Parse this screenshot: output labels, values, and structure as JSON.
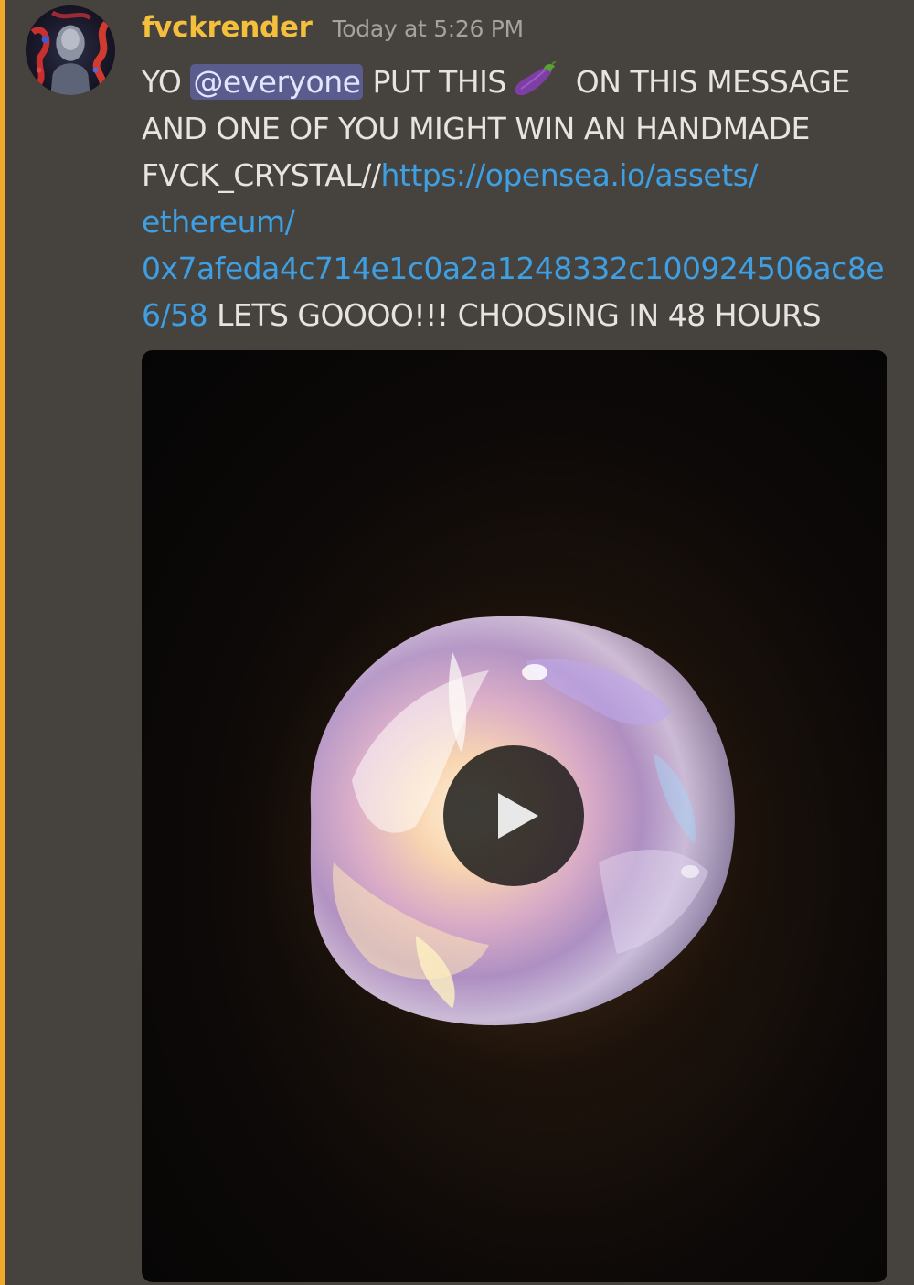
{
  "author": {
    "username": "fvckrender",
    "timestamp": "Today at 5:26 PM",
    "avatar_icon": "avatar-icon"
  },
  "message": {
    "lines": [
      {
        "parts": [
          {
            "type": "text",
            "value": "YO "
          },
          {
            "type": "mention",
            "value": "@everyone"
          },
          {
            "type": "text",
            "value": " PUT THIS"
          },
          {
            "type": "emoji",
            "value": "eggplant-emoji"
          },
          {
            "type": "text",
            "value": " ON THIS MESSAGE"
          }
        ]
      },
      {
        "parts": [
          {
            "type": "text",
            "value": "AND ONE OF YOU MIGHT WIN AN HANDMADE"
          }
        ]
      },
      {
        "parts": [
          {
            "type": "text",
            "value": "FVCK_CRYSTAL//"
          },
          {
            "type": "link",
            "value": "https://opensea.io/assets/"
          }
        ]
      },
      {
        "parts": [
          {
            "type": "link",
            "value": "ethereum/"
          }
        ]
      },
      {
        "parts": [
          {
            "type": "link",
            "value": "0x7afeda4c714e1c0a2a1248332c100924506ac8e"
          }
        ]
      },
      {
        "parts": [
          {
            "type": "link",
            "value": "6/58"
          },
          {
            "type": "text",
            "value": " LETS GOOOO!!! CHOOSING IN 48 HOURS"
          }
        ]
      }
    ]
  },
  "attachment": {
    "type": "video",
    "play_icon": "play-icon"
  },
  "colors": {
    "background": "#46423d",
    "mention_bar": "#f0a92a",
    "username": "#f5bf3e",
    "timestamp": "#a6a39f",
    "text": "#e6e4e1",
    "link": "#3e9fe3",
    "mention_bg": "#5a5c8e"
  }
}
